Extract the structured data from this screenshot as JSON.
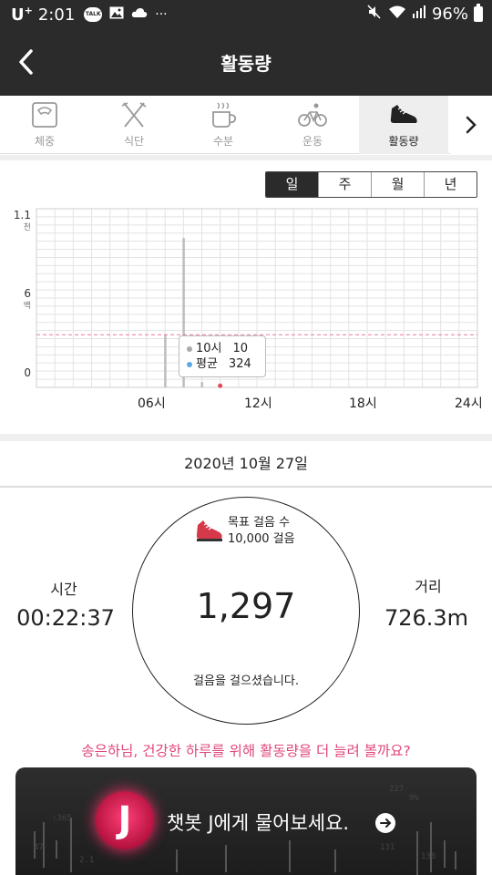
{
  "status_bar": {
    "carrier": "U",
    "carrier_sup": "+",
    "time": "2:01",
    "talk_badge": "TALK",
    "more": "···",
    "battery": "96%"
  },
  "header": {
    "title": "활동량",
    "back_icon": "chevron-left-icon"
  },
  "tabs": [
    {
      "label": "체중",
      "icon": "scale-icon",
      "active": false
    },
    {
      "label": "식단",
      "icon": "fork-knife-icon",
      "active": false
    },
    {
      "label": "수분",
      "icon": "cup-icon",
      "active": false
    },
    {
      "label": "운동",
      "icon": "bicycle-icon",
      "active": false
    },
    {
      "label": "활동량",
      "icon": "shoe-icon",
      "active": true
    }
  ],
  "period_tabs": [
    {
      "label": "일",
      "active": true
    },
    {
      "label": "주",
      "active": false
    },
    {
      "label": "월",
      "active": false
    },
    {
      "label": "년",
      "active": false
    }
  ],
  "chart_data": {
    "type": "bar",
    "x_unit": "hour",
    "xlim": [
      0,
      24
    ],
    "x_ticks": [
      "06시",
      "12시",
      "18시",
      "24시"
    ],
    "y_ticks": [
      {
        "value": "1.1",
        "unit": "천"
      },
      {
        "value": "6",
        "unit": "백"
      },
      {
        "value": "0",
        "unit": ""
      }
    ],
    "ylim": [
      0,
      1100
    ],
    "bars": [
      {
        "hour": 7,
        "value": 324
      },
      {
        "hour": 8,
        "value": 920
      },
      {
        "hour": 9,
        "value": 33
      },
      {
        "hour": 10,
        "value": 10
      }
    ],
    "average": 324,
    "average_color": "#e87a95",
    "bar_color": "#bdbdbd",
    "tooltip": {
      "row1_label": "10시",
      "row1_value": "10",
      "row2_label": "평균",
      "row2_value": "324"
    },
    "grid": true
  },
  "date": "2020년 10월 27일",
  "goal": {
    "label": "목표 걸음 수",
    "value": "10,000 걸음"
  },
  "steps": {
    "count": "1,297",
    "caption": "걸음을 걸으셨습니다."
  },
  "time_stat": {
    "label": "시간",
    "value": "00:22:37"
  },
  "distance_stat": {
    "label": "거리",
    "value": "726.3m"
  },
  "encourage_text": "송은하님, 건강한 하루를 위해 활동량을 더 늘려 볼까요?",
  "chatbot": {
    "logo": "J",
    "text": "챗봇 J에게 물어보세요.",
    "arrow_icon": "arrow-right-icon"
  },
  "colors": {
    "dark": "#2b2b2b",
    "accent_pink": "#e0467c",
    "tab_active_bg": "#eeeeee"
  }
}
